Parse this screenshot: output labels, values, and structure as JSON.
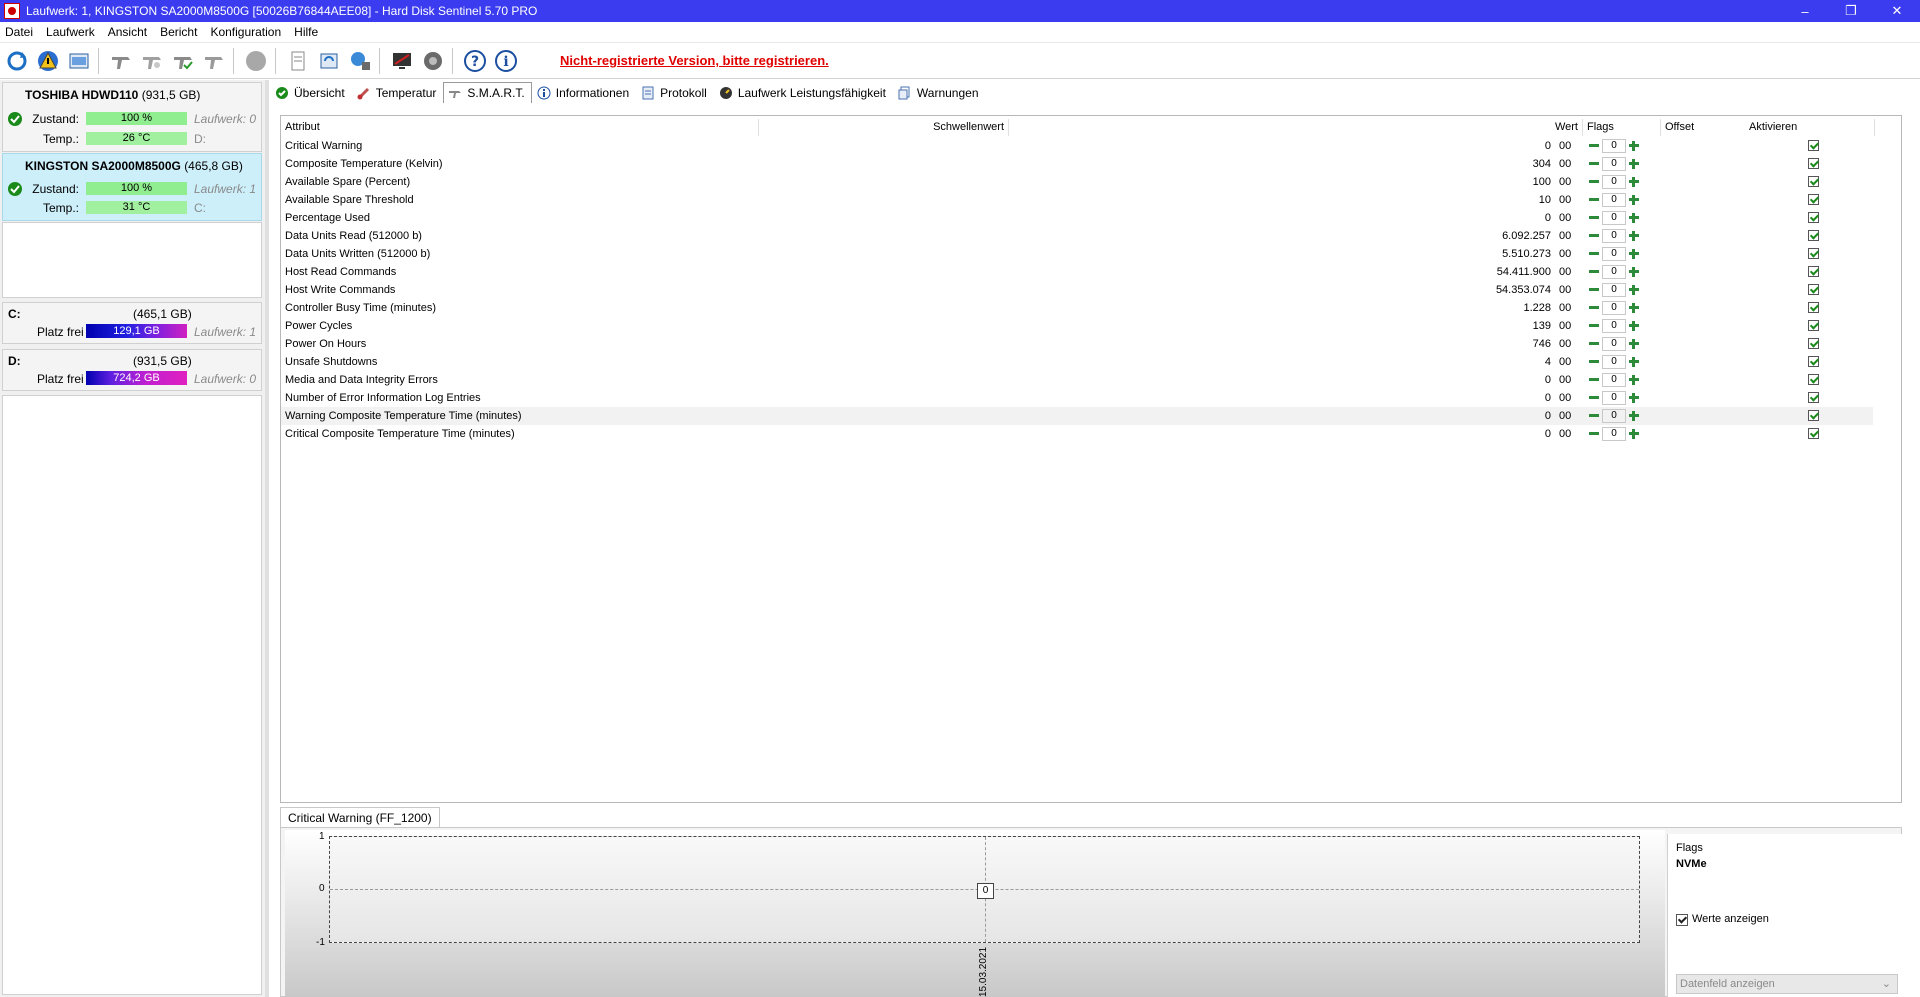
{
  "window": {
    "title": "Laufwerk: 1, KINGSTON SA2000M8500G [50026B76844AEE08]  -  Hard Disk Sentinel 5.70 PRO",
    "controls": [
      "–",
      "❐",
      "✕"
    ]
  },
  "menu": [
    "Datei",
    "Laufwerk",
    "Ansicht",
    "Bericht",
    "Konfiguration",
    "Hilfe"
  ],
  "toolbar": {
    "icons": [
      "refresh-icon",
      "warning-icon",
      "report-icon",
      "drive-icon-1",
      "drive-icon-2",
      "drive-check-icon",
      "drive-icon-4",
      "disk-icon",
      "document-icon",
      "sync-icon",
      "network-icon",
      "monitor-icon",
      "speaker-icon",
      "help-icon",
      "info-icon"
    ],
    "register_note": "Nicht-registrierte Version, bitte registrieren."
  },
  "disks": [
    {
      "name": "TOSHIBA HDWD110",
      "size": "(931,5 GB)",
      "status_label": "Zustand:",
      "health": "100 %",
      "health_pct": 100,
      "temp_label": "Temp.:",
      "temp": "26 °C",
      "drive": "Laufwerk: 0",
      "letter": "D:"
    },
    {
      "name": "KINGSTON SA2000M8500G",
      "size": "(465,8 GB)",
      "status_label": "Zustand:",
      "health": "100 %",
      "health_pct": 100,
      "temp_label": "Temp.:",
      "temp": "31 °C",
      "drive": "Laufwerk: 1",
      "letter": "C:"
    }
  ],
  "volumes": [
    {
      "name": "C:",
      "size": "(465,1 GB)",
      "free_label": "Platz frei",
      "free": "129,1 GB",
      "drive": "Laufwerk: 1"
    },
    {
      "name": "D:",
      "size": "(931,5 GB)",
      "free_label": "Platz frei",
      "free": "724,2 GB",
      "drive": "Laufwerk: 0"
    }
  ],
  "tabs": [
    "Übersicht",
    "Temperatur",
    "S.M.A.R.T.",
    "Informationen",
    "Protokoll",
    "Laufwerk Leistungsfähigkeit",
    "Warnungen"
  ],
  "active_tab": "S.M.A.R.T.",
  "smart": {
    "headers": {
      "attr": "Attribut",
      "threshold": "Schwellenwert",
      "value": "Wert",
      "flags": "Flags",
      "offset": "Offset",
      "enable": "Aktivieren"
    },
    "rows": [
      {
        "attr": "Critical Warning",
        "value": "0",
        "flags": "00",
        "offset": "0"
      },
      {
        "attr": "Composite Temperature (Kelvin)",
        "value": "304",
        "flags": "00",
        "offset": "0"
      },
      {
        "attr": "Available Spare (Percent)",
        "value": "100",
        "flags": "00",
        "offset": "0"
      },
      {
        "attr": "Available Spare Threshold",
        "value": "10",
        "flags": "00",
        "offset": "0"
      },
      {
        "attr": "Percentage Used",
        "value": "0",
        "flags": "00",
        "offset": "0"
      },
      {
        "attr": "Data Units Read (512000 b)",
        "value": "6.092.257",
        "flags": "00",
        "offset": "0"
      },
      {
        "attr": "Data Units Written (512000 b)",
        "value": "5.510.273",
        "flags": "00",
        "offset": "0"
      },
      {
        "attr": "Host Read Commands",
        "value": "54.411.900",
        "flags": "00",
        "offset": "0"
      },
      {
        "attr": "Host Write Commands",
        "value": "54.353.074",
        "flags": "00",
        "offset": "0"
      },
      {
        "attr": "Controller Busy Time (minutes)",
        "value": "1.228",
        "flags": "00",
        "offset": "0"
      },
      {
        "attr": "Power Cycles",
        "value": "139",
        "flags": "00",
        "offset": "0"
      },
      {
        "attr": "Power On Hours",
        "value": "746",
        "flags": "00",
        "offset": "0"
      },
      {
        "attr": "Unsafe Shutdowns",
        "value": "4",
        "flags": "00",
        "offset": "0"
      },
      {
        "attr": "Media and Data Integrity Errors",
        "value": "0",
        "flags": "00",
        "offset": "0"
      },
      {
        "attr": "Number of Error Information Log Entries",
        "value": "0",
        "flags": "00",
        "offset": "0"
      },
      {
        "attr": "Warning Composite Temperature Time (minutes)",
        "value": "0",
        "flags": "00",
        "offset": "0"
      },
      {
        "attr": "Critical Composite Temperature Time (minutes)",
        "value": "0",
        "flags": "00",
        "offset": "0"
      }
    ]
  },
  "graph": {
    "tab_label": "Critical Warning (FF_1200)",
    "y_ticks": [
      "1",
      "0",
      "-1"
    ],
    "point_value": "0",
    "date_label": "15.03.2021",
    "flags_label": "Flags",
    "flags_value": "NVMe",
    "show_values_label": "Werte anzeigen",
    "datafield_label": "Datenfeld anzeigen"
  }
}
